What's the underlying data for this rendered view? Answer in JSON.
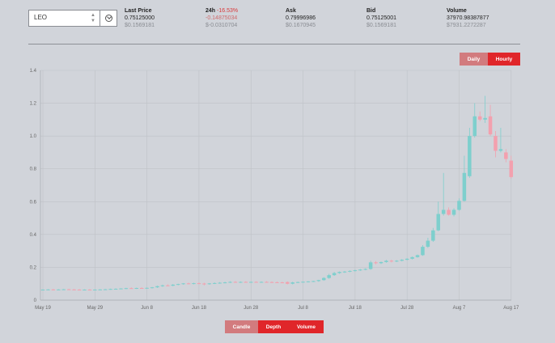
{
  "selector": {
    "value": "LEO"
  },
  "stats": [
    {
      "head": "Last Price",
      "head_extra": "",
      "value": "0.75125000",
      "usd": "$0.1569181"
    },
    {
      "head": "24h",
      "head_extra": "-16.53%",
      "value": "-0.14875034",
      "usd": "$-0.0310704"
    },
    {
      "head": "Ask",
      "head_extra": "",
      "value": "0.79996986",
      "usd": "$0.1670945"
    },
    {
      "head": "Bid",
      "head_extra": "",
      "value": "0.75125001",
      "usd": "$0.1569181"
    },
    {
      "head": "Volume",
      "head_extra": "",
      "value": "37970.98387877",
      "usd": "$7931.2272287"
    }
  ],
  "interval": {
    "daily": "Daily",
    "hourly": "Hourly",
    "selected": "Hourly"
  },
  "views": {
    "candle": "Candle",
    "depth": "Depth",
    "volume": "Volume",
    "selected": "Candle"
  },
  "colors": {
    "up": "#7ecfcd",
    "down": "#f3a0ae",
    "accent": "#e0262a"
  },
  "chart_data": {
    "type": "candlestick",
    "title": "",
    "xlabel": "",
    "ylabel": "",
    "ylim": [
      0,
      1.4
    ],
    "yticks": [
      "0",
      "0.2",
      "0.4",
      "0.6",
      "0.8",
      "1.0",
      "1.2",
      "1.4"
    ],
    "xticks": [
      "May 19",
      "May 29",
      "Jun 8",
      "Jun 18",
      "Jun 28",
      "Jul 8",
      "Jul 18",
      "Jul 28",
      "Aug 7",
      "Aug 17"
    ],
    "grid": true,
    "candles": [
      {
        "x": "May 19",
        "o": 0.063,
        "h": 0.066,
        "l": 0.06,
        "c": 0.064
      },
      {
        "x": "May 20",
        "o": 0.064,
        "h": 0.067,
        "l": 0.061,
        "c": 0.065
      },
      {
        "x": "May 21",
        "o": 0.065,
        "h": 0.068,
        "l": 0.062,
        "c": 0.064
      },
      {
        "x": "May 22",
        "o": 0.064,
        "h": 0.067,
        "l": 0.061,
        "c": 0.065
      },
      {
        "x": "May 23",
        "o": 0.065,
        "h": 0.068,
        "l": 0.062,
        "c": 0.066
      },
      {
        "x": "May 24",
        "o": 0.066,
        "h": 0.069,
        "l": 0.063,
        "c": 0.065
      },
      {
        "x": "May 25",
        "o": 0.065,
        "h": 0.068,
        "l": 0.062,
        "c": 0.064
      },
      {
        "x": "May 26",
        "o": 0.064,
        "h": 0.067,
        "l": 0.061,
        "c": 0.063
      },
      {
        "x": "May 27",
        "o": 0.063,
        "h": 0.066,
        "l": 0.06,
        "c": 0.064
      },
      {
        "x": "May 28",
        "o": 0.064,
        "h": 0.067,
        "l": 0.061,
        "c": 0.063
      },
      {
        "x": "May 29",
        "o": 0.063,
        "h": 0.066,
        "l": 0.06,
        "c": 0.064
      },
      {
        "x": "May 30",
        "o": 0.064,
        "h": 0.067,
        "l": 0.061,
        "c": 0.065
      },
      {
        "x": "May 31",
        "o": 0.065,
        "h": 0.068,
        "l": 0.062,
        "c": 0.066
      },
      {
        "x": "Jun 1",
        "o": 0.066,
        "h": 0.07,
        "l": 0.063,
        "c": 0.068
      },
      {
        "x": "Jun 2",
        "o": 0.068,
        "h": 0.072,
        "l": 0.065,
        "c": 0.069
      },
      {
        "x": "Jun 3",
        "o": 0.069,
        "h": 0.073,
        "l": 0.066,
        "c": 0.071
      },
      {
        "x": "Jun 4",
        "o": 0.071,
        "h": 0.075,
        "l": 0.067,
        "c": 0.073
      },
      {
        "x": "Jun 5",
        "o": 0.073,
        "h": 0.077,
        "l": 0.069,
        "c": 0.072
      },
      {
        "x": "Jun 6",
        "o": 0.072,
        "h": 0.076,
        "l": 0.068,
        "c": 0.074
      },
      {
        "x": "Jun 7",
        "o": 0.074,
        "h": 0.078,
        "l": 0.07,
        "c": 0.073
      },
      {
        "x": "Jun 8",
        "o": 0.073,
        "h": 0.077,
        "l": 0.069,
        "c": 0.075
      },
      {
        "x": "Jun 9",
        "o": 0.075,
        "h": 0.08,
        "l": 0.071,
        "c": 0.078
      },
      {
        "x": "Jun 10",
        "o": 0.078,
        "h": 0.088,
        "l": 0.074,
        "c": 0.085
      },
      {
        "x": "Jun 11",
        "o": 0.085,
        "h": 0.094,
        "l": 0.081,
        "c": 0.09
      },
      {
        "x": "Jun 12",
        "o": 0.09,
        "h": 0.096,
        "l": 0.084,
        "c": 0.088
      },
      {
        "x": "Jun 13",
        "o": 0.088,
        "h": 0.098,
        "l": 0.085,
        "c": 0.094
      },
      {
        "x": "Jun 14",
        "o": 0.094,
        "h": 0.1,
        "l": 0.09,
        "c": 0.098
      },
      {
        "x": "Jun 15",
        "o": 0.098,
        "h": 0.104,
        "l": 0.094,
        "c": 0.102
      },
      {
        "x": "Jun 16",
        "o": 0.102,
        "h": 0.106,
        "l": 0.097,
        "c": 0.1
      },
      {
        "x": "Jun 17",
        "o": 0.1,
        "h": 0.106,
        "l": 0.096,
        "c": 0.103
      },
      {
        "x": "Jun 18",
        "o": 0.103,
        "h": 0.108,
        "l": 0.098,
        "c": 0.101
      },
      {
        "x": "Jun 19",
        "o": 0.101,
        "h": 0.106,
        "l": 0.09,
        "c": 0.098
      },
      {
        "x": "Jun 20",
        "o": 0.098,
        "h": 0.104,
        "l": 0.094,
        "c": 0.102
      },
      {
        "x": "Jun 21",
        "o": 0.102,
        "h": 0.108,
        "l": 0.098,
        "c": 0.104
      },
      {
        "x": "Jun 22",
        "o": 0.104,
        "h": 0.11,
        "l": 0.1,
        "c": 0.106
      },
      {
        "x": "Jun 23",
        "o": 0.106,
        "h": 0.112,
        "l": 0.102,
        "c": 0.108
      },
      {
        "x": "Jun 24",
        "o": 0.108,
        "h": 0.115,
        "l": 0.104,
        "c": 0.111
      },
      {
        "x": "Jun 25",
        "o": 0.111,
        "h": 0.116,
        "l": 0.106,
        "c": 0.109
      },
      {
        "x": "Jun 26",
        "o": 0.109,
        "h": 0.114,
        "l": 0.105,
        "c": 0.111
      },
      {
        "x": "Jun 27",
        "o": 0.111,
        "h": 0.115,
        "l": 0.107,
        "c": 0.11
      },
      {
        "x": "Jun 28",
        "o": 0.11,
        "h": 0.114,
        "l": 0.106,
        "c": 0.111
      },
      {
        "x": "Jun 29",
        "o": 0.111,
        "h": 0.115,
        "l": 0.107,
        "c": 0.11
      },
      {
        "x": "Jun 30",
        "o": 0.11,
        "h": 0.114,
        "l": 0.106,
        "c": 0.111
      },
      {
        "x": "Jul 1",
        "o": 0.111,
        "h": 0.115,
        "l": 0.107,
        "c": 0.11
      },
      {
        "x": "Jul 2",
        "o": 0.11,
        "h": 0.114,
        "l": 0.106,
        "c": 0.109
      },
      {
        "x": "Jul 3",
        "o": 0.109,
        "h": 0.113,
        "l": 0.105,
        "c": 0.108
      },
      {
        "x": "Jul 4",
        "o": 0.108,
        "h": 0.112,
        "l": 0.104,
        "c": 0.107
      },
      {
        "x": "Jul 5",
        "o": 0.11,
        "h": 0.114,
        "l": 0.096,
        "c": 0.1
      },
      {
        "x": "Jul 6",
        "o": 0.1,
        "h": 0.112,
        "l": 0.096,
        "c": 0.108
      },
      {
        "x": "Jul 7",
        "o": 0.108,
        "h": 0.113,
        "l": 0.104,
        "c": 0.11
      },
      {
        "x": "Jul 8",
        "o": 0.11,
        "h": 0.114,
        "l": 0.106,
        "c": 0.112
      },
      {
        "x": "Jul 9",
        "o": 0.112,
        "h": 0.116,
        "l": 0.108,
        "c": 0.114
      },
      {
        "x": "Jul 10",
        "o": 0.114,
        "h": 0.118,
        "l": 0.11,
        "c": 0.116
      },
      {
        "x": "Jul 11",
        "o": 0.116,
        "h": 0.124,
        "l": 0.112,
        "c": 0.122
      },
      {
        "x": "Jul 12",
        "o": 0.122,
        "h": 0.14,
        "l": 0.118,
        "c": 0.135
      },
      {
        "x": "Jul 13",
        "o": 0.135,
        "h": 0.16,
        "l": 0.13,
        "c": 0.152
      },
      {
        "x": "Jul 14",
        "o": 0.152,
        "h": 0.172,
        "l": 0.148,
        "c": 0.165
      },
      {
        "x": "Jul 15",
        "o": 0.165,
        "h": 0.175,
        "l": 0.16,
        "c": 0.172
      },
      {
        "x": "Jul 16",
        "o": 0.172,
        "h": 0.178,
        "l": 0.166,
        "c": 0.174
      },
      {
        "x": "Jul 17",
        "o": 0.174,
        "h": 0.182,
        "l": 0.17,
        "c": 0.178
      },
      {
        "x": "Jul 18",
        "o": 0.178,
        "h": 0.186,
        "l": 0.174,
        "c": 0.182
      },
      {
        "x": "Jul 19",
        "o": 0.182,
        "h": 0.19,
        "l": 0.178,
        "c": 0.186
      },
      {
        "x": "Jul 20",
        "o": 0.186,
        "h": 0.194,
        "l": 0.182,
        "c": 0.19
      },
      {
        "x": "Jul 21",
        "o": 0.19,
        "h": 0.24,
        "l": 0.185,
        "c": 0.23
      },
      {
        "x": "Jul 22",
        "o": 0.23,
        "h": 0.238,
        "l": 0.218,
        "c": 0.225
      },
      {
        "x": "Jul 23",
        "o": 0.225,
        "h": 0.235,
        "l": 0.22,
        "c": 0.232
      },
      {
        "x": "Jul 24",
        "o": 0.232,
        "h": 0.245,
        "l": 0.228,
        "c": 0.24
      },
      {
        "x": "Jul 25",
        "o": 0.24,
        "h": 0.246,
        "l": 0.23,
        "c": 0.236
      },
      {
        "x": "Jul 26",
        "o": 0.236,
        "h": 0.244,
        "l": 0.232,
        "c": 0.24
      },
      {
        "x": "Jul 27",
        "o": 0.24,
        "h": 0.25,
        "l": 0.236,
        "c": 0.246
      },
      {
        "x": "Jul 28",
        "o": 0.246,
        "h": 0.256,
        "l": 0.242,
        "c": 0.252
      },
      {
        "x": "Jul 29",
        "o": 0.252,
        "h": 0.266,
        "l": 0.248,
        "c": 0.262
      },
      {
        "x": "Jul 30",
        "o": 0.262,
        "h": 0.278,
        "l": 0.258,
        "c": 0.274
      },
      {
        "x": "Jul 31",
        "o": 0.274,
        "h": 0.335,
        "l": 0.27,
        "c": 0.325
      },
      {
        "x": "Aug 1",
        "o": 0.325,
        "h": 0.38,
        "l": 0.318,
        "c": 0.362
      },
      {
        "x": "Aug 2",
        "o": 0.362,
        "h": 0.44,
        "l": 0.355,
        "c": 0.425
      },
      {
        "x": "Aug 3",
        "o": 0.425,
        "h": 0.6,
        "l": 0.42,
        "c": 0.525
      },
      {
        "x": "Aug 4",
        "o": 0.525,
        "h": 0.775,
        "l": 0.515,
        "c": 0.55
      },
      {
        "x": "Aug 5",
        "o": 0.55,
        "h": 0.565,
        "l": 0.515,
        "c": 0.52
      },
      {
        "x": "Aug 6",
        "o": 0.52,
        "h": 0.56,
        "l": 0.51,
        "c": 0.55
      },
      {
        "x": "Aug 7",
        "o": 0.55,
        "h": 0.62,
        "l": 0.545,
        "c": 0.605
      },
      {
        "x": "Aug 8",
        "o": 0.605,
        "h": 0.88,
        "l": 0.6,
        "c": 0.775
      },
      {
        "x": "Aug 9",
        "o": 0.755,
        "h": 1.05,
        "l": 0.745,
        "c": 1.0
      },
      {
        "x": "Aug 10",
        "o": 1.0,
        "h": 1.2,
        "l": 0.99,
        "c": 1.12
      },
      {
        "x": "Aug 11",
        "o": 1.12,
        "h": 1.15,
        "l": 1.09,
        "c": 1.1
      },
      {
        "x": "Aug 12",
        "o": 1.1,
        "h": 1.245,
        "l": 1.08,
        "c": 1.11
      },
      {
        "x": "Aug 13",
        "o": 1.12,
        "h": 1.19,
        "l": 1.0,
        "c": 1.01
      },
      {
        "x": "Aug 14",
        "o": 1.0,
        "h": 1.03,
        "l": 0.87,
        "c": 0.91
      },
      {
        "x": "Aug 15",
        "o": 0.91,
        "h": 1.05,
        "l": 0.9,
        "c": 0.92
      },
      {
        "x": "Aug 16",
        "o": 0.9,
        "h": 0.92,
        "l": 0.84,
        "c": 0.86
      },
      {
        "x": "Aug 17",
        "o": 0.85,
        "h": 0.88,
        "l": 0.74,
        "c": 0.75
      }
    ]
  }
}
